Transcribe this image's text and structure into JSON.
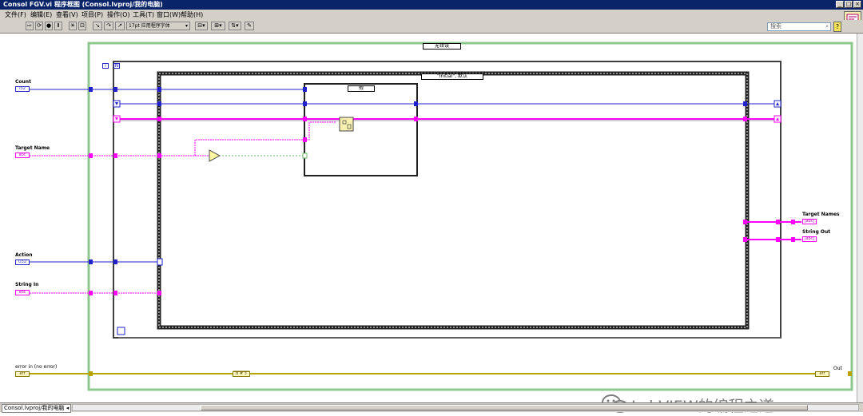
{
  "window": {
    "title": "Consol FGV.vi 程序框图 (Consol.lvproj/我的电脑)",
    "buttons": [
      "_",
      "□",
      "×"
    ]
  },
  "menu": [
    "文件(F)",
    "编辑(E)",
    "查看(V)",
    "项目(P)",
    "操作(O)",
    "工具(T)",
    "窗口(W)",
    "帮助(H)"
  ],
  "toolbar": {
    "font_label": "17pt 应用程序字体",
    "search_placeholder": "搜索"
  },
  "diagram": {
    "outer_case_selector": "无错误",
    "while_iteration": "i",
    "while_count": "N",
    "inner_case_selector": "\"Initial\", 默认",
    "nested_case_selector": "假",
    "unbundle_label": "8 # 3",
    "controls": [
      {
        "label": "Count",
        "term": "I32"
      },
      {
        "label": "Target Name",
        "term": "abc"
      },
      {
        "label": "Action",
        "term": "U32"
      },
      {
        "label": "String In",
        "term": "abc"
      },
      {
        "label": "error in (no error)",
        "term": "err"
      }
    ],
    "indicators": [
      {
        "label": "Target Names",
        "term": "[abc]"
      },
      {
        "label": "String Out",
        "term": "[abc]"
      },
      {
        "label": "Out",
        "term": "err"
      }
    ]
  },
  "statusbar": {
    "project": "Consol.lvproj/我的电脑"
  },
  "watermark": "LabVIEW的编程之道",
  "colors": {
    "int_wire": "#2222cc",
    "string_wire": "#ff00ff",
    "error_wire": "#b8a400",
    "loop_border": "#8ec88e"
  }
}
